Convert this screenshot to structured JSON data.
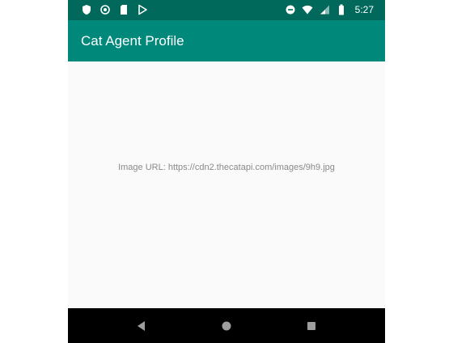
{
  "status_bar": {
    "time": "5:27",
    "left_icons": [
      "shield-icon",
      "sync-icon",
      "sd-card-icon",
      "play-store-icon"
    ],
    "right_icons": [
      "do-not-disturb-icon",
      "wifi-icon",
      "cell-signal-icon",
      "battery-icon"
    ]
  },
  "app_bar": {
    "title": "Cat Agent Profile"
  },
  "content": {
    "image_url_text": "Image URL: https://cdn2.thecatapi.com/images/9h9.jpg"
  },
  "nav_bar": {
    "buttons": [
      "back-icon",
      "home-icon",
      "recents-icon"
    ]
  },
  "colors": {
    "status_bar": "#00695c",
    "app_bar": "#00897b",
    "background": "#fafafa",
    "nav_bar": "#000000",
    "url_text": "#8a8a8a"
  }
}
